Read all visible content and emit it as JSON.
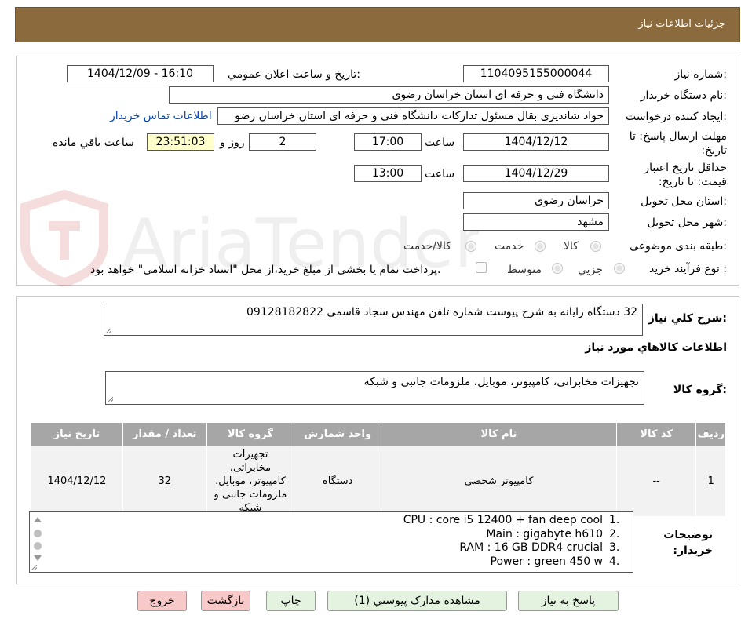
{
  "header": {
    "title": "جزئیات اطلاعات نیاز"
  },
  "form": {
    "need_number": {
      "label": "شماره نیاز:",
      "value": "1104095155000044"
    },
    "announce_datetime": {
      "label": "تاریخ و ساعت اعلان عمومي:",
      "value": "1404/12/09 - 16:10"
    },
    "buyer_org": {
      "label": "نام دستگاه خريدار:",
      "value": "دانشگاه فنی و حرفه ای استان خراسان رضوی"
    },
    "requester": {
      "label": "ايجاد کننده درخواست:",
      "value": "جواد شانديزی بقال مسئول تداركات دانشگاه فنی و حرفه ای استان خراسان رضو",
      "link": "اطلاعات تماس خريدار"
    },
    "reply_deadline": {
      "label": "مهلت ارسال پاسخ: تا تاريخ:",
      "date": "1404/12/12",
      "time_label": "ساعت",
      "time": "17:00",
      "days": "2",
      "days_label": "روز و",
      "remaining": "23:51:03",
      "remaining_label": "ساعت باقي مانده"
    },
    "price_validity": {
      "label": "حداقل تاريخ اعتبار قيمت: تا تاريخ:",
      "date": "1404/12/29",
      "time_label": "ساعت",
      "time": "13:00"
    },
    "province": {
      "label": "استان محل تحويل:",
      "value": "خراسان رضوی"
    },
    "city": {
      "label": "شهر محل تحويل:",
      "value": "مشهد"
    },
    "category": {
      "label": "طبقه بندی موضوعی:",
      "options": [
        "کالا",
        "خدمت",
        "کالا/خدمت"
      ]
    },
    "purchase_type": {
      "label": "نوع فرآيند خريد :",
      "options": [
        "جزيي",
        "متوسط"
      ],
      "payment_note": "پرداخت تمام يا بخشی از مبلغ خريد،از محل \"اسناد خزانه اسلامی\" خواهد بود."
    }
  },
  "summary": {
    "label": "شرح كلي نياز:",
    "value": "32 دستگاه رایانه به شرح پیوست شماره تلفن مهندس سجاد قاسمی 09128182822"
  },
  "goods_section": {
    "title": "اطلاعات كالاهاي مورد نياز",
    "group_label": "گروه كالا:",
    "group_value": "تجهیزات مخابراتی، کامپیوتر، موبایل، ملزومات جانبی و شبکه"
  },
  "table": {
    "headers": [
      "رديف",
      "كد كالا",
      "نام كالا",
      "واحد شمارش",
      "گروه كالا",
      "تعداد / مقدار",
      "تاريخ نياز"
    ],
    "rows": [
      {
        "row": "1",
        "code": "--",
        "name": "کامپیوتر شخصی",
        "unit": "دستگاه",
        "group": "تجهیزات مخابراتی، کامپیوتر، موبایل، ملزومات جانبی و شبکه",
        "quantity": "32",
        "date": "1404/12/12"
      }
    ]
  },
  "buyer_notes": {
    "label": "توضيحات خريدار:",
    "items": [
      {
        "num": "1.",
        "text": "CPU : core i5 12400 + fan deep cool"
      },
      {
        "num": "2.",
        "text": "Main : gigabyte h610"
      },
      {
        "num": "3.",
        "text": "RAM : 16 GB DDR4 crucial"
      },
      {
        "num": "4.",
        "text": "Power : green 450 w"
      }
    ]
  },
  "buttons": {
    "reply": "پاسخ به نياز",
    "attachments": "مشاهده مدارک پيوستي (1)",
    "print": "چاپ",
    "back": "بازگشت",
    "exit": "خروج"
  },
  "watermark": {
    "text": "AriaTender.neT"
  },
  "colors": {
    "header_bg": "#8b6b3d",
    "table_header_bg": "#a6a6a6",
    "remaining_bg": "#ffffcc",
    "link": "#0645ad",
    "button_green": "#e3f3e0",
    "button_pink": "#f7c9c9"
  }
}
